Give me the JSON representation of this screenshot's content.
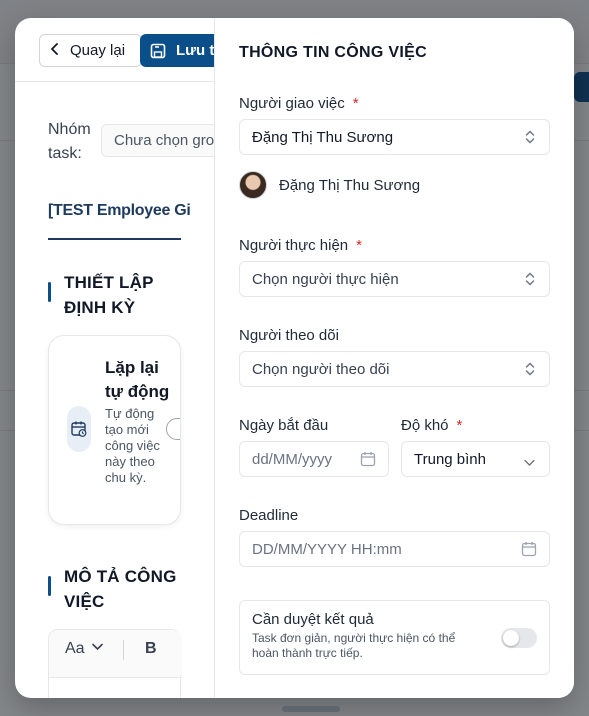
{
  "toolbar": {
    "back_label": "Quay lại",
    "save_label": "Lưu task"
  },
  "left": {
    "group_label": "Nhóm task:",
    "group_placeholder": "Chưa chọn group",
    "task_title": "[TEST Employee Gi",
    "schedule_heading": "THIẾT LẬP ĐỊNH KỲ",
    "repeat": {
      "title": "Lặp lại tự động",
      "description": "Tự động tạo mới công việc này theo chu kỳ.",
      "enabled": false
    },
    "description_heading": "MÔ TẢ CÔNG VIỆC",
    "editor": {
      "font_label": "Aa",
      "bold_label": "B"
    }
  },
  "right": {
    "title": "THÔNG TIN CÔNG VIỆC",
    "assigner": {
      "label": "Người giao việc",
      "required": "*",
      "value": "Đặng Thị Thu Sương",
      "selected_name": "Đặng Thị Thu Sương"
    },
    "executor": {
      "label": "Người thực hiện",
      "required": "*",
      "placeholder": "Chọn người thực hiện"
    },
    "follower": {
      "label": "Người theo dõi",
      "placeholder": "Chọn người theo dõi"
    },
    "start_date": {
      "label": "Ngày bắt đầu",
      "placeholder": "dd/MM/yyyy"
    },
    "difficulty": {
      "label": "Độ khó",
      "required": "*",
      "value": "Trung bình"
    },
    "deadline": {
      "label": "Deadline",
      "placeholder": "DD/MM/YYYY HH:mm"
    },
    "approval": {
      "title": "Cần duyệt kết quả",
      "description": "Task đơn giản, người thực hiện có thể hoàn thành trực tiếp.",
      "enabled": false
    }
  },
  "colors": {
    "primary": "#0b4f8a",
    "required": "#dc2626",
    "overlay": "rgba(20,24,31,0.52)"
  }
}
